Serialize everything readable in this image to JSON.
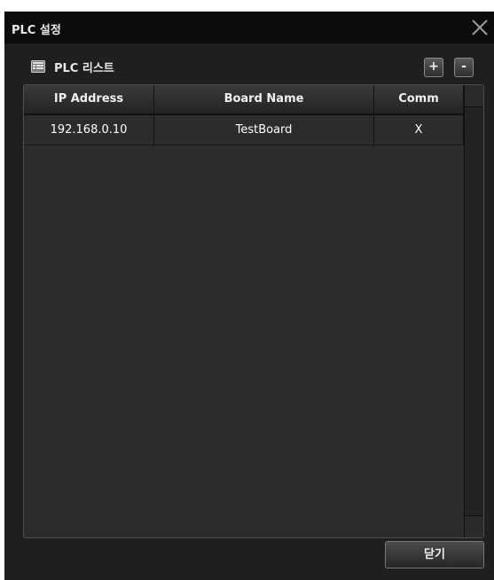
{
  "window": {
    "title": "PLC 설정"
  },
  "panel": {
    "title": "PLC 리스트",
    "add_label": "+",
    "remove_label": "-"
  },
  "table": {
    "columns": [
      "IP Address",
      "Board Name",
      "Comm"
    ],
    "rows": [
      [
        "192.168.0.10",
        "TestBoard",
        "X"
      ]
    ]
  },
  "footer": {
    "close_label": "닫기"
  },
  "icons": {
    "close": "close-icon",
    "list": "list-icon"
  }
}
